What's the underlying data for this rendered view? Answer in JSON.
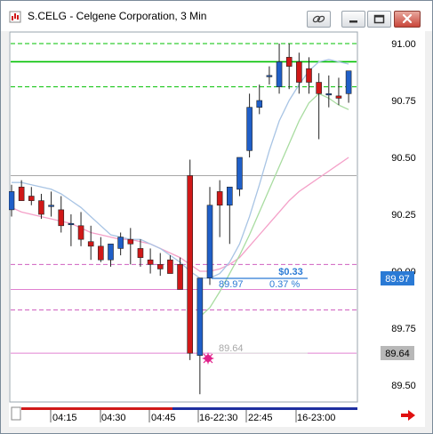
{
  "window": {
    "title": "S.CELG - Celgene Corporation, 3 Min"
  },
  "price_axis": {
    "ticks": [
      "91.00",
      "90.75",
      "90.50",
      "90.25",
      "90.00",
      "89.75",
      "89.50"
    ],
    "last_price_label": "89.97",
    "marker_label": "89.64"
  },
  "time_axis": {
    "ticks": [
      "04:15",
      "04:30",
      "04:45",
      "16-22:30",
      "22:45",
      "16-23:00"
    ]
  },
  "annotations": {
    "change_value": "$0.33",
    "change_percent": "0.37 %",
    "entry_price": "89.97",
    "marker_price": "89.64"
  },
  "colors": {
    "up_candle": "#1f5fc8",
    "down_candle": "#d01818",
    "accent_green": "#00c000",
    "price_box_blue": "#2a7ad5",
    "marker_magenta": "#e0208a"
  },
  "chart_data": {
    "type": "candlestick",
    "ylim": [
      89.43,
      91.08
    ],
    "candles": [
      {
        "o": 90.27,
        "h": 90.38,
        "l": 90.24,
        "c": 90.35
      },
      {
        "o": 90.37,
        "h": 90.4,
        "l": 90.31,
        "c": 90.31
      },
      {
        "o": 90.33,
        "h": 90.37,
        "l": 90.29,
        "c": 90.31
      },
      {
        "o": 90.31,
        "h": 90.34,
        "l": 90.23,
        "c": 90.25
      },
      {
        "o": 90.29,
        "h": 90.35,
        "l": 90.24,
        "c": 90.29
      },
      {
        "o": 90.27,
        "h": 90.33,
        "l": 90.17,
        "c": 90.2
      },
      {
        "o": 90.21,
        "h": 90.25,
        "l": 90.11,
        "c": 90.21
      },
      {
        "o": 90.2,
        "h": 90.26,
        "l": 90.11,
        "c": 90.14
      },
      {
        "o": 90.13,
        "h": 90.2,
        "l": 90.05,
        "c": 90.11
      },
      {
        "o": 90.11,
        "h": 90.15,
        "l": 90.04,
        "c": 90.05
      },
      {
        "o": 90.05,
        "h": 90.09,
        "l": 90.02,
        "c": 90.12
      },
      {
        "o": 90.1,
        "h": 90.17,
        "l": 90.07,
        "c": 90.15
      },
      {
        "o": 90.14,
        "h": 90.19,
        "l": 90.03,
        "c": 90.12
      },
      {
        "o": 90.1,
        "h": 90.14,
        "l": 90.02,
        "c": 90.06
      },
      {
        "o": 90.05,
        "h": 90.1,
        "l": 89.99,
        "c": 90.03
      },
      {
        "o": 90.03,
        "h": 90.08,
        "l": 89.98,
        "c": 90.01
      },
      {
        "o": 90.05,
        "h": 90.07,
        "l": 89.99,
        "c": 89.99
      },
      {
        "o": 90.03,
        "h": 90.06,
        "l": 89.95,
        "c": 89.92
      },
      {
        "o": 90.42,
        "h": 90.49,
        "l": 89.61,
        "c": 89.64
      },
      {
        "o": 89.63,
        "h": 89.97,
        "l": 89.46,
        "c": 89.97
      },
      {
        "o": 89.97,
        "h": 90.37,
        "l": 89.94,
        "c": 90.29
      },
      {
        "o": 90.35,
        "h": 90.4,
        "l": 90.15,
        "c": 90.29
      },
      {
        "o": 90.29,
        "h": 90.37,
        "l": 90.12,
        "c": 90.37
      },
      {
        "o": 90.36,
        "h": 90.5,
        "l": 90.33,
        "c": 90.5
      },
      {
        "o": 90.53,
        "h": 90.78,
        "l": 90.5,
        "c": 90.72
      },
      {
        "o": 90.72,
        "h": 90.82,
        "l": 90.69,
        "c": 90.75
      },
      {
        "o": 90.86,
        "h": 90.9,
        "l": 90.82,
        "c": 90.86
      },
      {
        "o": 90.81,
        "h": 91.0,
        "l": 90.78,
        "c": 90.92
      },
      {
        "o": 90.94,
        "h": 91.0,
        "l": 90.8,
        "c": 90.9
      },
      {
        "o": 90.92,
        "h": 90.96,
        "l": 90.78,
        "c": 90.83
      },
      {
        "o": 90.89,
        "h": 90.94,
        "l": 90.78,
        "c": 90.83
      },
      {
        "o": 90.83,
        "h": 90.87,
        "l": 90.58,
        "c": 90.78
      },
      {
        "o": 90.78,
        "h": 90.86,
        "l": 90.72,
        "c": 90.78
      },
      {
        "o": 90.77,
        "h": 90.85,
        "l": 90.73,
        "c": 90.76
      },
      {
        "o": 90.78,
        "h": 90.88,
        "l": 90.74,
        "c": 90.88
      }
    ],
    "moving_average_blue": [
      90.39,
      90.39,
      90.38,
      90.37,
      90.36,
      90.34,
      90.31,
      90.28,
      90.24,
      90.2,
      90.16,
      90.15,
      90.14,
      90.14,
      90.12,
      90.1,
      90.07,
      90.04,
      90.0,
      89.97,
      89.97,
      89.99,
      90.04,
      90.12,
      90.24,
      90.38,
      90.53,
      90.66,
      90.75,
      90.82,
      90.88,
      90.92,
      90.93,
      90.92,
      90.91
    ],
    "moving_average_green": [
      null,
      null,
      null,
      null,
      null,
      null,
      null,
      null,
      null,
      null,
      null,
      null,
      null,
      null,
      null,
      null,
      null,
      null,
      null,
      89.8,
      89.84,
      89.91,
      89.99,
      90.07,
      90.16,
      90.26,
      90.36,
      90.46,
      90.56,
      90.66,
      90.74,
      90.78,
      90.76,
      90.73,
      90.71
    ],
    "moving_average_pink": [
      90.28,
      90.26,
      90.25,
      90.24,
      90.23,
      90.22,
      90.21,
      90.19,
      90.17,
      90.16,
      90.15,
      90.14,
      90.14,
      90.13,
      90.12,
      90.1,
      90.08,
      90.06,
      90.03,
      90.0,
      90.0,
      90.01,
      90.03,
      90.06,
      90.11,
      90.16,
      90.21,
      90.26,
      90.31,
      90.35,
      90.38,
      90.41,
      90.44,
      90.47,
      90.5
    ],
    "horizontal_levels": [
      {
        "price": 91.0,
        "style": "dash",
        "color": "#00c000"
      },
      {
        "price": 90.92,
        "style": "solid",
        "color": "#00c000"
      },
      {
        "price": 90.81,
        "style": "dash",
        "color": "#00c000"
      },
      {
        "price": 90.42,
        "style": "solid",
        "color": "#a8a8a8"
      },
      {
        "price": 90.03,
        "style": "dash",
        "color": "#d060c0"
      },
      {
        "price": 89.92,
        "style": "solid",
        "color": "#e080d0"
      },
      {
        "price": 89.83,
        "style": "dash",
        "color": "#d060c0"
      },
      {
        "price": 89.64,
        "style": "solid",
        "color": "#e080d0"
      }
    ]
  }
}
